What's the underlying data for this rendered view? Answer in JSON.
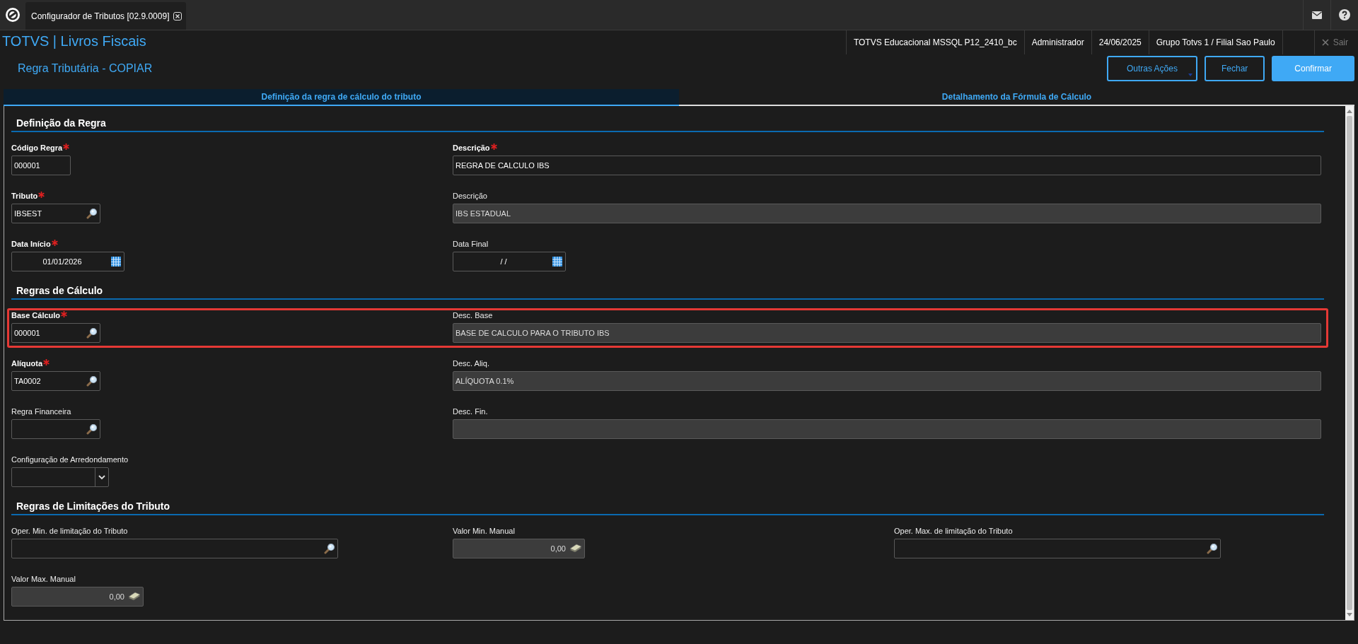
{
  "app_tabs": [
    {
      "label": "Configurador de Tributos [02.9.0009]",
      "selected": true
    }
  ],
  "header": {
    "title": "TOTVS | Livros Fiscais",
    "info": [
      "TOTVS Educacional MSSQL P12_2410_bc",
      "Administrador",
      "24/06/2025",
      "Grupo Totvs 1 / Filial Sao Paulo"
    ],
    "exit": {
      "label": "Sair",
      "disabled": true
    }
  },
  "page": {
    "title": "Regra Tributária - COPIAR",
    "actions": [
      {
        "label": "Outras Ações",
        "kind": "menu"
      },
      {
        "label": "Fechar",
        "kind": "outline"
      },
      {
        "label": "Confirmar",
        "kind": "primary"
      }
    ]
  },
  "tabs": [
    {
      "label": "Definição da regra de cálculo do tributo",
      "selected": true
    },
    {
      "label": "Detalhamento da Fórmula de Cálculo",
      "selected": false
    }
  ],
  "sections": [
    {
      "title": "Definição da Regra",
      "rows": [
        {
          "highlighted": false,
          "fields": [
            {
              "label": "Código Regra",
              "required": true,
              "kind": "text",
              "readonly": false,
              "value": "000001"
            },
            {
              "label": "Descrição",
              "required": true,
              "kind": "text",
              "readonly": false,
              "value": "REGRA DE CALCULO IBS"
            }
          ]
        },
        {
          "highlighted": false,
          "fields": [
            {
              "label": "Tributo",
              "required": true,
              "kind": "lookup",
              "readonly": false,
              "value": "IBSEST"
            },
            {
              "label": "Descrição",
              "required": false,
              "kind": "text",
              "readonly": true,
              "value": "IBS ESTADUAL"
            }
          ]
        },
        {
          "highlighted": false,
          "fields": [
            {
              "label": "Data Início",
              "required": true,
              "kind": "date",
              "readonly": false,
              "value": "01/01/2026"
            },
            {
              "label": "Data Final",
              "required": false,
              "kind": "date",
              "readonly": false,
              "value": "/  /"
            }
          ]
        }
      ]
    },
    {
      "title": "Regras de Cálculo",
      "rows": [
        {
          "highlighted": true,
          "fields": [
            {
              "label": "Base Cálculo",
              "required": true,
              "kind": "lookup",
              "readonly": false,
              "value": "000001"
            },
            {
              "label": "Desc. Base",
              "required": false,
              "kind": "text",
              "readonly": true,
              "value": "BASE DE CALCULO PARA O TRIBUTO IBS"
            }
          ]
        },
        {
          "highlighted": false,
          "fields": [
            {
              "label": "Alíquota",
              "required": true,
              "kind": "lookup",
              "readonly": false,
              "value": "TA0002"
            },
            {
              "label": "Desc. Aliq.",
              "required": false,
              "kind": "text",
              "readonly": true,
              "value": "ALÍQUOTA 0.1%"
            }
          ]
        },
        {
          "highlighted": false,
          "fields": [
            {
              "label": "Regra Financeira",
              "required": false,
              "kind": "lookup",
              "readonly": false
            },
            {
              "label": "Desc. Fin.",
              "required": false,
              "kind": "text",
              "readonly": true
            }
          ]
        },
        {
          "highlighted": false,
          "fields": [
            {
              "label": "Configuração de Arredondamento",
              "required": false,
              "kind": "dropdown",
              "readonly": false
            }
          ]
        }
      ]
    },
    {
      "title": "Regras de Limitações do Tributo",
      "rows": [
        {
          "highlighted": false,
          "fields": [
            {
              "label": "Oper. Min. de limitação do Tributo",
              "required": false,
              "kind": "lookup",
              "readonly": false
            },
            {
              "label": "Valor Min. Manual",
              "required": false,
              "kind": "currency",
              "readonly": true,
              "value": "0,00"
            },
            {
              "label": "Oper. Max. de limitação do Tributo",
              "required": false,
              "kind": "lookup",
              "readonly": false
            }
          ]
        },
        {
          "highlighted": false,
          "fields": [
            {
              "label": "Valor Max. Manual",
              "required": false,
              "kind": "currency",
              "readonly": true,
              "value": "0,00"
            }
          ]
        }
      ]
    }
  ]
}
